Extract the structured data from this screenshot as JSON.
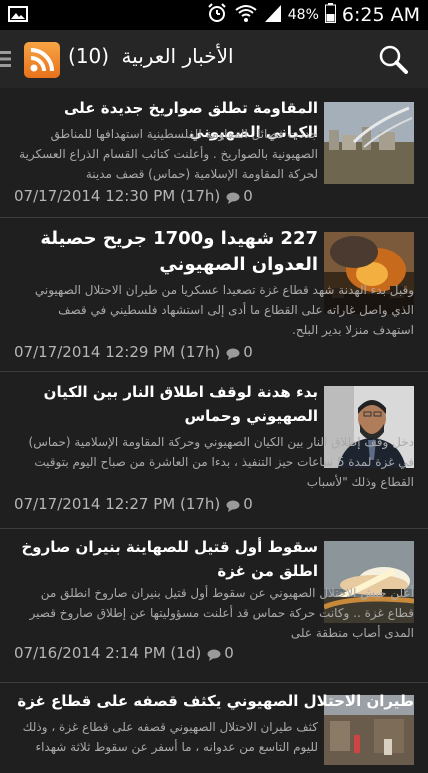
{
  "status": {
    "battery": "48%",
    "time": "6:25 AM"
  },
  "appbar": {
    "title": "الأخبار العربية",
    "count": "(10)"
  },
  "articles": [
    {
      "headline": "المقاومة تطلق صواريخ جديدة على الكياني الصهيوني",
      "snippet": "جددت فصائل المقاومة الفلسطينية استهدافها للمناطق الصهيونية بالصواريخ . وأعلنت كتائب القسام الذراع العسكرية لحركة المقاومة الإسلامية (حماس) قصف مدينة",
      "date": "07/17/2014 12:30 PM (17h)",
      "comments": "0"
    },
    {
      "headline": "227 شهيدا و1700 جريح حصيلة العدوان الصهيوني",
      "snippet": "وقبل بدء الهدنة شهد قطاع غزة تصعيدا عسكريا من طيران الاحتلال الصهيوني الذي واصل غاراته على القطاع ما أدى إلى استشهاد فلسطيني في قصف استهدف منزلا بدير البلح.",
      "date": "07/17/2014 12:29 PM (17h)",
      "comments": "0"
    },
    {
      "headline": "بدء هدنة لوقف اطلاق النار بين الكيان الصهيوني وحماس",
      "snippet": "دخل وقف إطلاق النار بين الكيان الصهيوني وحركة المقاومة الإسلامية (حماس) في غزة لمدة 5 ساعات حيز التنفيذ ، بدءا من العاشرة من صباح اليوم بتوقيت القطاع وذلك \"لأسباب",
      "date": "07/17/2014 12:27 PM (17h)",
      "comments": "0"
    },
    {
      "headline": "سقوط أول قتيل للصهاينة بنيران صاروخ اطلق من غزة",
      "snippet": "أعلن جيش الاحتلال الصهيوني عن سقوط أول قتيل بنيران صاروخ انطلق من قطاع غزة .. وكانت حركة حماس قد أعلنت مسؤوليتها عن إطلاق صاروخ قصير المدى أصاب منطقة على",
      "date": "07/16/2014 2:14 PM (1d)",
      "comments": "0"
    },
    {
      "headline": "طيران الاحتلال الصهيوني يكثف قصفه على قطاع غزة",
      "snippet": "كثف طيران الاحتلال الصهيوني قصفه على قطاع غزة ، وذلك لليوم التاسع من عدوانه ، ما أسفر عن سقوط ثلاثة شهداء",
      "date": "",
      "comments": ""
    }
  ]
}
